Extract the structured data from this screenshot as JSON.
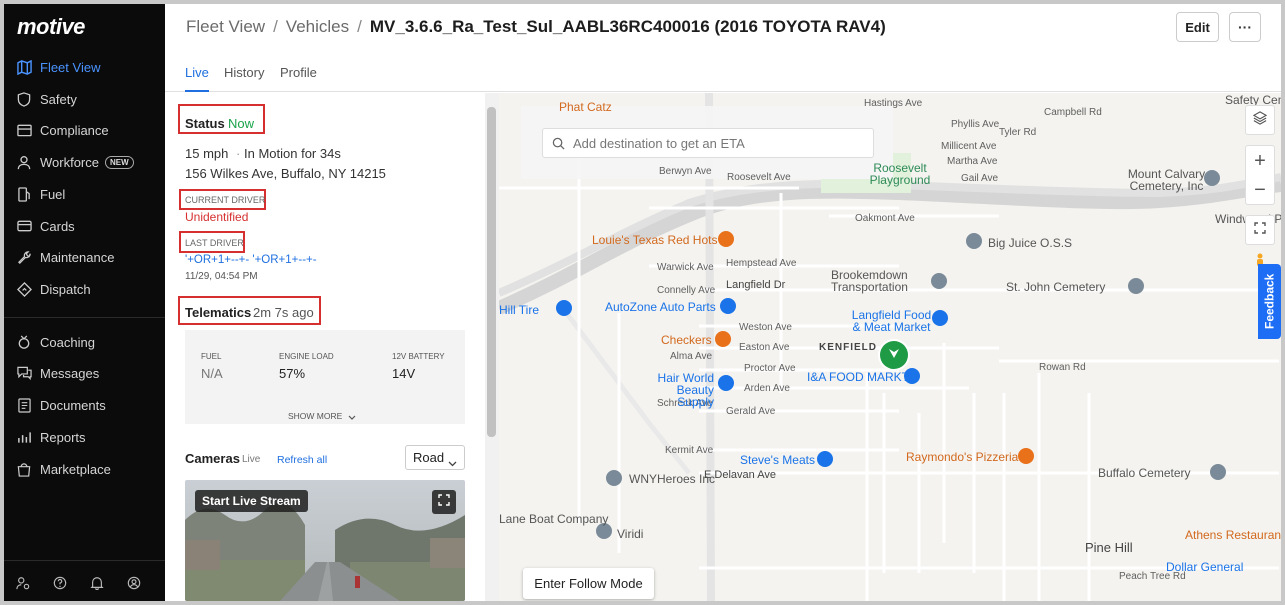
{
  "brand": {
    "logo": "motive"
  },
  "sidebar": {
    "items": [
      {
        "label": "Fleet View",
        "icon": "map-icon"
      },
      {
        "label": "Safety",
        "icon": "shield-icon"
      },
      {
        "label": "Compliance",
        "icon": "compliance-icon"
      },
      {
        "label": "Workforce",
        "icon": "user-icon",
        "badge": "NEW"
      },
      {
        "label": "Fuel",
        "icon": "fuel-icon"
      },
      {
        "label": "Cards",
        "icon": "card-icon"
      },
      {
        "label": "Maintenance",
        "icon": "wrench-icon"
      },
      {
        "label": "Dispatch",
        "icon": "dispatch-icon"
      },
      {
        "label": "Coaching",
        "icon": "coaching-icon"
      },
      {
        "label": "Messages",
        "icon": "messages-icon"
      },
      {
        "label": "Documents",
        "icon": "documents-icon"
      },
      {
        "label": "Reports",
        "icon": "reports-icon"
      },
      {
        "label": "Marketplace",
        "icon": "marketplace-icon"
      }
    ],
    "bottom_icons": [
      "account-settings-icon",
      "help-icon",
      "notifications-icon",
      "profile-icon"
    ]
  },
  "header": {
    "breadcrumb": [
      "Fleet View",
      "Vehicles",
      "MV_3.6.6_Ra_Test_Sul_AABL36RC400016 (2016 TOYOTA RAV4)"
    ],
    "edit_label": "Edit",
    "more_label": "···"
  },
  "tabs": [
    "Live",
    "History",
    "Profile"
  ],
  "status": {
    "label": "Status",
    "value": "Now",
    "speed": "15 mph",
    "motion": "In Motion for 34s",
    "address": "156 Wilkes Ave, Buffalo, NY 14215",
    "current_driver_label": "CURRENT DRIVER",
    "current_driver": "Unidentified",
    "last_driver_label": "LAST DRIVER",
    "last_driver": "'+OR+1+--+- '+OR+1+--+-",
    "last_driver_time": "11/29, 04:54 PM"
  },
  "telematics": {
    "label": "Telematics",
    "ago": "2m 7s ago",
    "fuel_label": "FUEL",
    "fuel": "N/A",
    "engine_label": "ENGINE LOAD",
    "engine": "57%",
    "battery_label": "12V BATTERY",
    "battery": "14V",
    "show_more": "SHOW MORE"
  },
  "cameras": {
    "label": "Cameras",
    "live": "Live",
    "refresh": "Refresh all",
    "select": "Road",
    "live_stream": "Start Live Stream"
  },
  "map": {
    "search_placeholder": "Add destination to get an ETA",
    "follow": "Enter Follow Mode",
    "feedback": "Feedback",
    "labels": [
      "Hastings Ave",
      "Campbell Rd",
      "Phyllis Ave",
      "Tyler Rd",
      "Millicent Ave",
      "Martha Ave",
      "Gail Ave",
      "Berwyn Ave",
      "Roosevelt Ave",
      "Oakmont Ave",
      "Hempstead Ave",
      "Warwick Ave",
      "Langfield Dr",
      "Connelly Ave",
      "Weston Ave",
      "Easton Ave",
      "Alma Ave",
      "Proctor Ave",
      "Arden Ave",
      "Schreck Ave",
      "Gerald Ave",
      "Kermit Ave",
      "Rowan Rd",
      "E Delavan Ave",
      "Peach Tree Rd",
      "KENFIELD",
      "Pine Hill"
    ],
    "pois": [
      {
        "name": "Louie's Texas Red Hots",
        "color": "#e8711a"
      },
      {
        "name": "AutoZone Auto Parts",
        "color": "#1a73e8"
      },
      {
        "name": "Checkers",
        "color": "#e8711a"
      },
      {
        "name": "Hair World Beauty Supply",
        "color": "#1a73e8"
      },
      {
        "name": "Steve's Meats",
        "color": "#1a73e8"
      },
      {
        "name": "WNYHeroes Inc",
        "color": "#5f6368"
      },
      {
        "name": "Viridi",
        "color": "#5f6368"
      },
      {
        "name": "Big Juice O.S.S",
        "color": "#5f6368"
      },
      {
        "name": "Brookemdown Transportation",
        "color": "#5f6368"
      },
      {
        "name": "Langfield Food & Meat Market",
        "color": "#1a73e8"
      },
      {
        "name": "I&A FOOD MARKT",
        "color": "#1a73e8"
      },
      {
        "name": "Raymondo's Pizzeria",
        "color": "#e8711a"
      },
      {
        "name": "Buffalo Cemetery",
        "color": "#5f6368"
      },
      {
        "name": "St. John Cemetery",
        "color": "#5f6368"
      },
      {
        "name": "Mount Calvary Cemetery, Inc",
        "color": "#5f6368"
      },
      {
        "name": "Dollar General",
        "color": "#1a73e8"
      },
      {
        "name": "Athens Restaurant",
        "color": "#e8711a"
      },
      {
        "name": "Roosevelt Playground",
        "color": "#34a853"
      },
      {
        "name": "Safety Cemetery",
        "color": "#5f6368"
      },
      {
        "name": "Windwood Place",
        "color": "#5f6368"
      },
      {
        "name": "Lane Boat Company",
        "color": "#5f6368"
      },
      {
        "name": "Hill Tire",
        "color": "#1a73e8"
      },
      {
        "name": "Phat Catz",
        "color": "#e8711a"
      }
    ]
  },
  "colors": {
    "accent": "#1f6fe0",
    "status_now": "#1aa34a",
    "alert": "#d62f2f",
    "link": "#1f6fe0",
    "vehicle": "#1f9a45"
  }
}
